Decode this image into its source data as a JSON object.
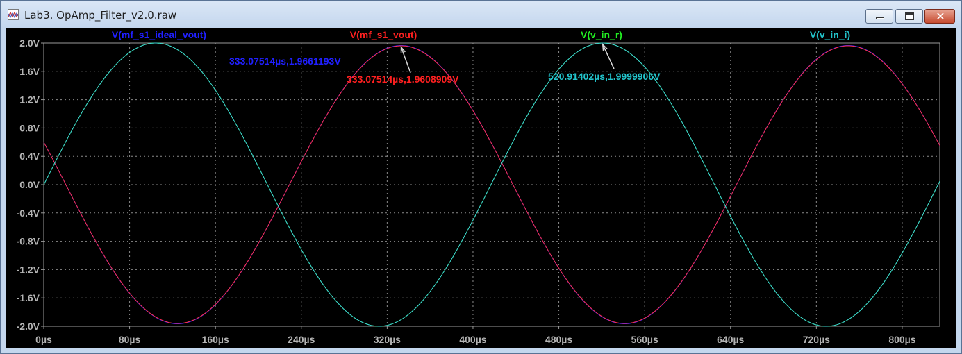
{
  "window": {
    "title": "Lab3. OpAmp_Filter_v2.0.raw",
    "buttons": {
      "minimize": "minimize-icon",
      "maximize": "maximize-icon",
      "close": "✕"
    }
  },
  "chart_data": {
    "type": "line",
    "xlabel": "",
    "ylabel": "",
    "xlim": [
      0,
      835
    ],
    "ylim": [
      -2.0,
      2.0
    ],
    "grid": true,
    "background": "#000000",
    "x_ticks": [
      "0µs",
      "80µs",
      "160µs",
      "240µs",
      "320µs",
      "400µs",
      "480µs",
      "560µs",
      "640µs",
      "720µs",
      "800µs"
    ],
    "y_ticks": [
      "2.0V",
      "1.6V",
      "1.2V",
      "0.8V",
      "0.4V",
      "0.0V",
      "-0.4V",
      "-0.8V",
      "-1.2V",
      "-1.6V",
      "-2.0V"
    ],
    "legend": [
      {
        "name": "V(mf_s1_ideal_vout)",
        "color": "#2020ff"
      },
      {
        "name": "V(mf_s1_vout)",
        "color": "#ff2020"
      },
      {
        "name": "V(v_in_r)",
        "color": "#22ee22"
      },
      {
        "name": "V(v_in_i)",
        "color": "#22c4cc"
      }
    ],
    "series": [
      {
        "name": "V(mf_s1_ideal_vout)",
        "color": "#2020ff",
        "amplitude": 1.966,
        "frequency_hz": 2400,
        "peak_at_us": 333.075,
        "visible": "hidden under V(mf_s1_vout)"
      },
      {
        "name": "V(mf_s1_vout)",
        "color": "#ff2f50",
        "amplitude": 1.961,
        "frequency_hz": 2400,
        "peak_at_us": 333.075
      },
      {
        "name": "V(v_in_r)",
        "color": "#22ee22",
        "amplitude": 2.0,
        "frequency_hz": 2400,
        "peak_at_us": 520.914,
        "visible": "hidden under V(v_in_i)"
      },
      {
        "name": "V(v_in_i)",
        "color": "#3ecfd8",
        "amplitude": 2.0,
        "frequency_hz": 2400,
        "peak_at_us": 520.914
      }
    ],
    "annotations": [
      {
        "text": "333.07514µs,1.9661193V",
        "color": "#2020ff",
        "x_us": 333.075,
        "y_v": 1.9661
      },
      {
        "text": "333.07514µs,1.9608909V",
        "color": "#ff2020",
        "x_us": 333.075,
        "y_v": 1.9609
      },
      {
        "text": "520.91402µs,1.9999906V",
        "color": "#22c4cc",
        "x_us": 520.914,
        "y_v": 1.99999
      }
    ]
  }
}
